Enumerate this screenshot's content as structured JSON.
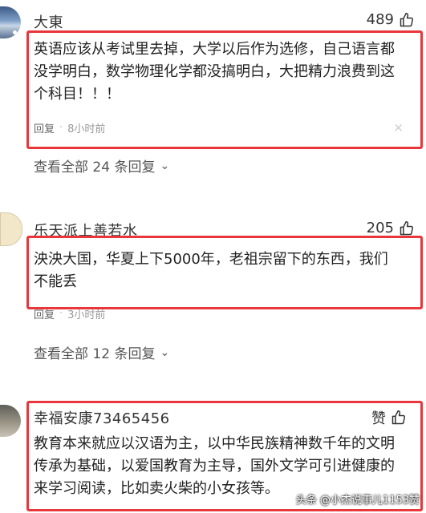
{
  "comments": [
    {
      "username": "大東",
      "likes": "489",
      "lines": [
        "英语应该从考试里去掉，大学以后作为选修，自己语言都",
        "没学明白，数学物理化学都没搞明白，大把精力浪费到这",
        "个科目！！！"
      ],
      "reply_label": "回复",
      "time": "8小时前",
      "view_all": "查看全部 24 条回复"
    },
    {
      "username": "乐天派上善若水",
      "likes": "205",
      "lines": [
        "泱泱大国，华夏上下5000年，老祖宗留下的东西，我们",
        "不能丢"
      ],
      "reply_label": "回复",
      "time": "3小时前",
      "view_all": "查看全部 12 条回复"
    },
    {
      "username": "幸福安康73465456",
      "likes": "赞",
      "lines": [
        "教育本来就应以汉语为主，以中华民族精神数千年的文明",
        "传承为基础，以爱国教育为主导，国外文学可引进健康的",
        "来学习阅读，比如卖火柴的小女孩等。"
      ]
    }
  ],
  "close_symbol": "×",
  "chevron": "⌄",
  "watermark": "头条 @小杰说事儿1153赞",
  "icons": {
    "like": "thumbs-up-icon",
    "close": "close-icon"
  },
  "colors": {
    "highlight": "#e8363b",
    "text": "#222222"
  }
}
